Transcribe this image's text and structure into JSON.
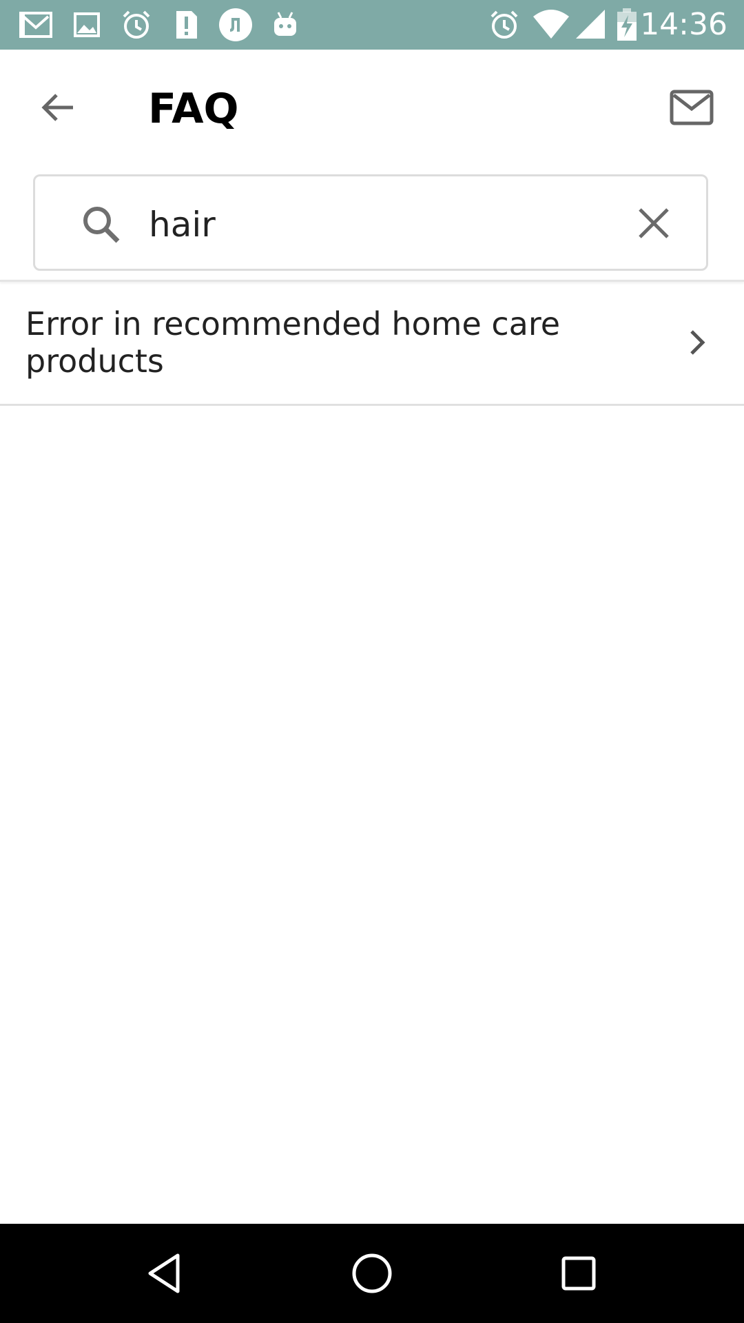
{
  "status_bar": {
    "time": "14:36",
    "notification_icons": [
      "gmail-icon",
      "image-icon",
      "alarm-icon",
      "sim-alert-icon",
      "app-icon",
      "android-icon"
    ],
    "system_icons": [
      "alarm-icon",
      "wifi-icon",
      "signal-icon",
      "battery-charging-icon"
    ],
    "background_color": "#7faaa6"
  },
  "app_bar": {
    "title": "FAQ",
    "back_icon": "arrow-left-icon",
    "mail_icon": "mail-icon"
  },
  "search": {
    "value": "hair",
    "search_icon": "search-icon",
    "clear_icon": "close-icon"
  },
  "results": [
    {
      "title": "Error in recommended home care products",
      "icon": "chevron-right-icon"
    }
  ],
  "nav_bar": {
    "buttons": [
      "back-triangle-icon",
      "home-circle-icon",
      "recents-square-icon"
    ]
  }
}
